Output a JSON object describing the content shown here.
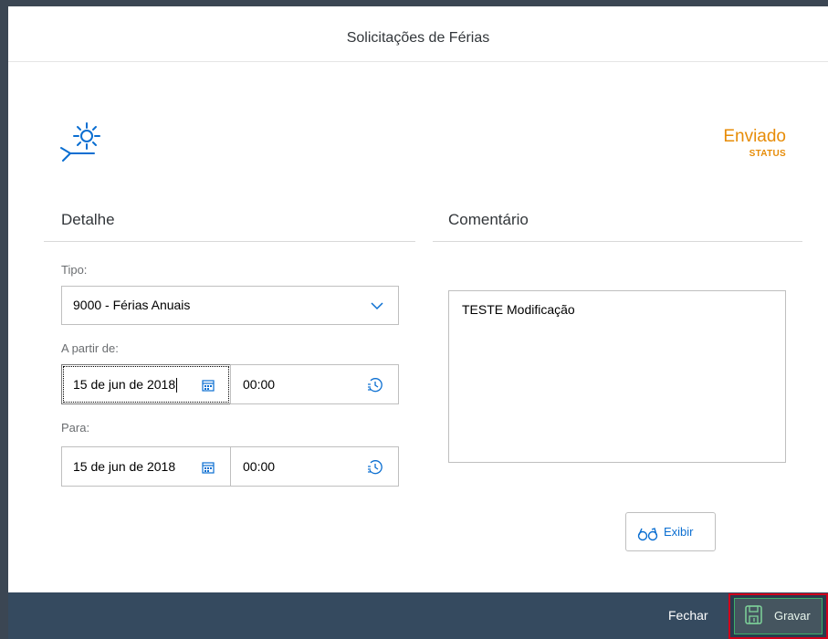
{
  "dialog": {
    "title": "Solicitações de Férias"
  },
  "status": {
    "value": "Enviado",
    "label": "STATUS",
    "color": "#e78c07"
  },
  "detail": {
    "section_title": "Detalhe",
    "type_label": "Tipo:",
    "type_value": "9000 - Férias Anuais",
    "from_label": "A partir de:",
    "from_date": "15 de jun de 2018",
    "from_time": "00:00",
    "to_label": "Para:",
    "to_date": "15 de jun de 2018",
    "to_time": "00:00"
  },
  "comment": {
    "section_title": "Comentário",
    "text": "TESTE Modificação",
    "view_button": "Exibir"
  },
  "footer": {
    "close_label": "Fechar",
    "save_label": "Gravar"
  },
  "icons": {
    "vacation": "sun-lounger-icon",
    "dropdown": "chevron-down-icon",
    "calendar": "calendar-icon",
    "time": "clock-icon",
    "view": "glasses-icon",
    "save": "save-icon"
  },
  "colors": {
    "accent": "#0a6ed1",
    "status": "#e78c07",
    "footer": "#354a5f",
    "highlight": "#d0021b"
  }
}
